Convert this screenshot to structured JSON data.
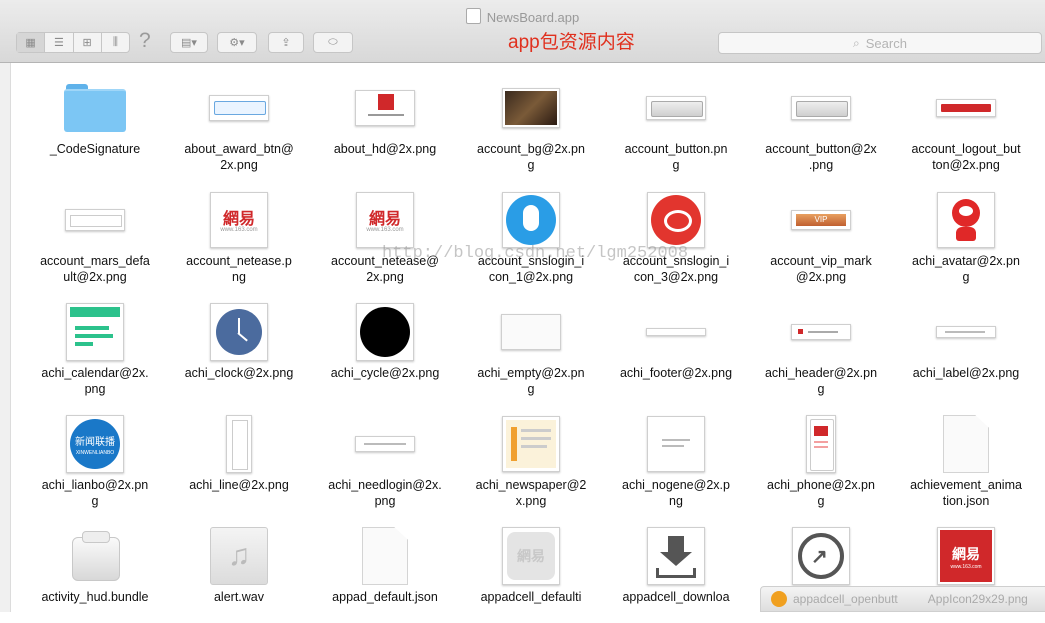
{
  "window": {
    "title": "NewsBoard.app",
    "annotation": "app包资源内容"
  },
  "toolbar": {
    "view_buttons": [
      "▦",
      "☰",
      "⊞",
      "⫼"
    ],
    "help": "?",
    "arrange": "▤▾",
    "action": "⚙▾",
    "share": "⇪",
    "tag": "⬭"
  },
  "search": {
    "placeholder": "Search",
    "icon": "search-icon"
  },
  "watermark": "http://blog.csdn.net/lgm252008",
  "notification": {
    "left": "appadcell_openbutt",
    "right": "AppIcon29x29.png"
  },
  "files": [
    {
      "name": "_CodeSignature",
      "kind": "folder"
    },
    {
      "name": "about_award_btn@2x.png",
      "kind": "award"
    },
    {
      "name": "about_hd@2x.png",
      "kind": "hd"
    },
    {
      "name": "account_bg@2x.png",
      "kind": "bg"
    },
    {
      "name": "account_button.png",
      "kind": "grey_button"
    },
    {
      "name": "account_button@2x.png",
      "kind": "grey_button"
    },
    {
      "name": "account_logout_button@2x.png",
      "kind": "red_bar"
    },
    {
      "name": "account_mars_default@2x.png",
      "kind": "mars"
    },
    {
      "name": "account_netease.png",
      "kind": "netease"
    },
    {
      "name": "account_netease@2x.png",
      "kind": "netease"
    },
    {
      "name": "account_snslogin_icon_1@2x.png",
      "kind": "qq"
    },
    {
      "name": "account_snslogin_icon_3@2x.png",
      "kind": "weibo"
    },
    {
      "name": "account_vip_mark@2x.png",
      "kind": "vip"
    },
    {
      "name": "achi_avatar@2x.png",
      "kind": "avatar"
    },
    {
      "name": "achi_calendar@2x.png",
      "kind": "calendar"
    },
    {
      "name": "achi_clock@2x.png",
      "kind": "clock"
    },
    {
      "name": "achi_cycle@2x.png",
      "kind": "cycle"
    },
    {
      "name": "achi_empty@2x.png",
      "kind": "empty"
    },
    {
      "name": "achi_footer@2x.png",
      "kind": "footer"
    },
    {
      "name": "achi_header@2x.png",
      "kind": "header"
    },
    {
      "name": "achi_label@2x.png",
      "kind": "label"
    },
    {
      "name": "achi_lianbo@2x.png",
      "kind": "lianbo",
      "text": "新闻联播",
      "sub": "XINWENLIANBO"
    },
    {
      "name": "achi_line@2x.png",
      "kind": "line"
    },
    {
      "name": "achi_needlogin@2x.png",
      "kind": "needlogin"
    },
    {
      "name": "achi_newspaper@2x.png",
      "kind": "newspaper"
    },
    {
      "name": "achi_nogene@2x.png",
      "kind": "nogene"
    },
    {
      "name": "achi_phone@2x.png",
      "kind": "phone"
    },
    {
      "name": "achievement_animation.json",
      "kind": "doc"
    },
    {
      "name": "activity_hud.bundle",
      "kind": "bundle"
    },
    {
      "name": "alert.wav",
      "kind": "wav"
    },
    {
      "name": "appad_default.json",
      "kind": "doc"
    },
    {
      "name": "appadcell_default",
      "kind": "appad_default"
    },
    {
      "name": "appadcell_download",
      "kind": "download"
    },
    {
      "name": "appadcell_openbutt",
      "kind": "openbutt"
    },
    {
      "name": "AppIcon29x29.png",
      "kind": "netease_red"
    }
  ],
  "labels": {
    "_CodeSignature": "_CodeSignature",
    "about_award_btn@2x.png": "about_award_btn@\n2x.png",
    "about_hd@2x.png": "about_hd@2x.png",
    "account_bg@2x.png": "account_bg@2x.pn\ng",
    "account_button.png": "account_button.pn\ng",
    "account_button@2x.png": "account_button@2x\n.png",
    "account_logout_button@2x.png": "account_logout_but\nton@2x.png",
    "account_mars_default@2x.png": "account_mars_defa\nult@2x.png",
    "account_netease.png": "account_netease.p\nng",
    "account_netease@2x.png": "account_netease@\n2x.png",
    "account_snslogin_icon_1@2x.png": "account_snslogin_i\ncon_1@2x.png",
    "account_snslogin_icon_3@2x.png": "account_snslogin_i\ncon_3@2x.png",
    "account_vip_mark@2x.png": "account_vip_mark\n@2x.png",
    "achi_avatar@2x.png": "achi_avatar@2x.pn\ng",
    "achi_calendar@2x.png": "achi_calendar@2x.\npng",
    "achi_clock@2x.png": "achi_clock@2x.png",
    "achi_cycle@2x.png": "achi_cycle@2x.png",
    "achi_empty@2x.png": "achi_empty@2x.pn\ng",
    "achi_footer@2x.png": "achi_footer@2x.png",
    "achi_header@2x.png": "achi_header@2x.pn\ng",
    "achi_label@2x.png": "achi_label@2x.png",
    "achi_lianbo@2x.png": "achi_lianbo@2x.pn\ng",
    "achi_line@2x.png": "achi_line@2x.png",
    "achi_needlogin@2x.png": "achi_needlogin@2x.\npng",
    "achi_newspaper@2x.png": "achi_newspaper@2\nx.png",
    "achi_nogene@2x.png": "achi_nogene@2x.p\nng",
    "achi_phone@2x.png": "achi_phone@2x.pn\ng",
    "achievement_animation.json": "achievement_anima\ntion.json",
    "activity_hud.bundle": "activity_hud.bundle",
    "alert.wav": "alert.wav",
    "appad_default.json": "appad_default.json",
    "appadcell_default": "appadcell_defaulti",
    "appadcell_download": "appadcell_downloa",
    "appadcell_openbutt": "",
    "AppIcon29x29.png": ""
  },
  "thumb_text": {
    "netease": "網易",
    "netease_sub": "www.163.com",
    "vip": "VIP"
  },
  "colors": {
    "annotation": "#e0301e",
    "folder": "#7cc6f4",
    "netease_red": "#d0282a",
    "qq_blue": "#2a9de6",
    "weibo_red": "#e2352e",
    "calendar_green": "#2cc28c",
    "clock_blue": "#4b6b9e",
    "lianbo_blue": "#1a78c8"
  }
}
